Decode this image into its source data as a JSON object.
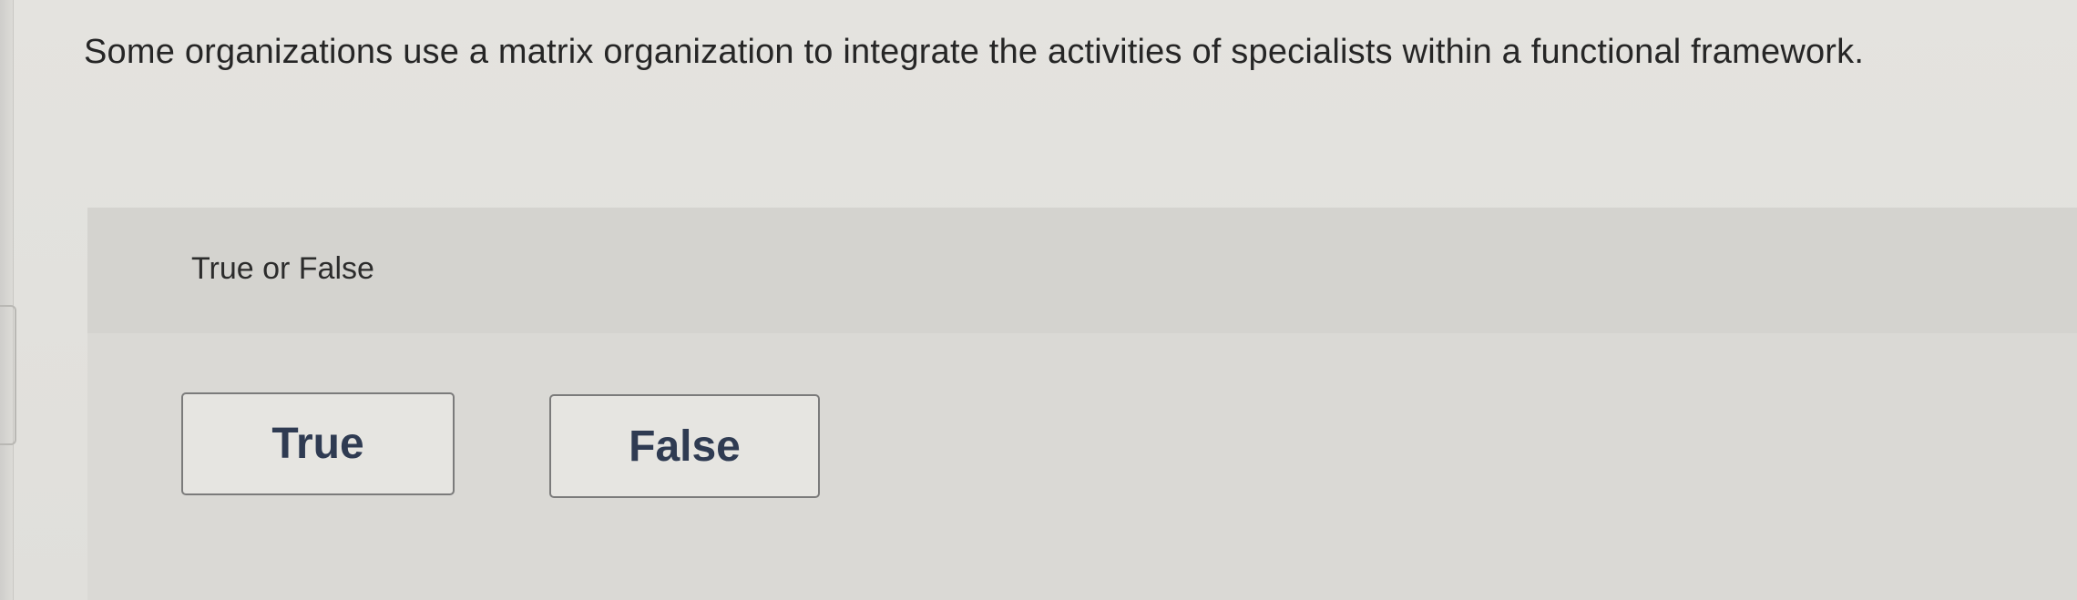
{
  "question": {
    "text": "Some organizations use a matrix organization to integrate the activities of specialists within a functional framework."
  },
  "answer_area": {
    "type_label": "True or False",
    "choices": [
      {
        "label": "True"
      },
      {
        "label": "False"
      }
    ]
  }
}
